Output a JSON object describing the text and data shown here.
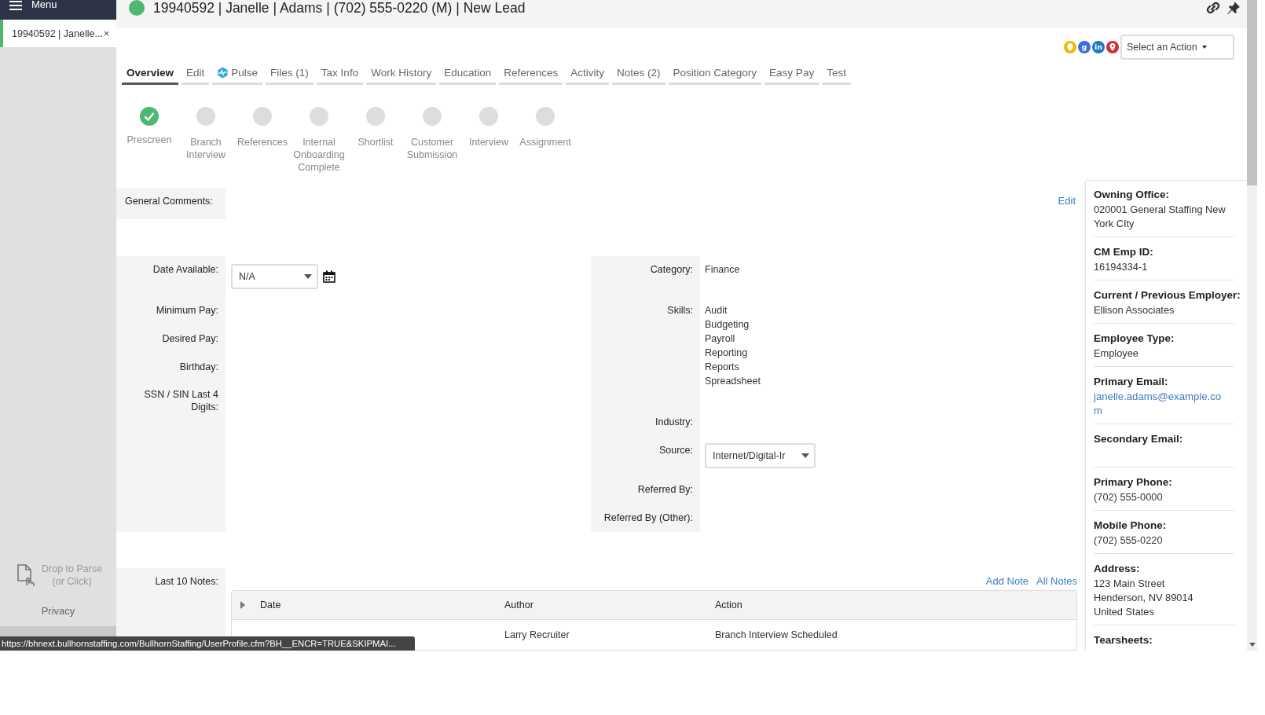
{
  "sidebar": {
    "menu_label": "Menu",
    "open_records": [
      {
        "label": "19940592 | Janelle...",
        "close": "×",
        "selected": true
      }
    ],
    "drop_zone": {
      "lines": [
        "Drop to Parse",
        "(or Click)"
      ]
    },
    "privacy_link": "Privacy"
  },
  "header": {
    "status_dot": {
      "color": "#4cb870"
    },
    "title": "19940592 | Janelle | Adams | (702) 555-0220 (M) | New Lead"
  },
  "quick_links": [
    {
      "kind": "idea"
    },
    {
      "kind": "search",
      "glyph": "g"
    },
    {
      "kind": "linkedin",
      "glyph": "in"
    },
    {
      "kind": "map"
    }
  ],
  "action_select": {
    "value": "Select an Action"
  },
  "tabs": [
    {
      "label": "Overview",
      "selected": true
    },
    {
      "label": "Edit",
      "selected": false
    },
    {
      "label": "Pulse",
      "kind": "with_icon",
      "selected": false
    },
    {
      "label": "Files (1)",
      "selected": false
    },
    {
      "label": "Tax Info",
      "selected": false
    },
    {
      "label": "Work History",
      "selected": false
    },
    {
      "label": "Education",
      "selected": false
    },
    {
      "label": "References",
      "selected": false
    },
    {
      "label": "Activity",
      "selected": false
    },
    {
      "label": "Notes (2)",
      "selected": false
    },
    {
      "label": "Position Category",
      "selected": false
    },
    {
      "label": "Easy Pay",
      "selected": false
    },
    {
      "label": "Test",
      "selected": false
    }
  ],
  "steps": [
    {
      "label": "Prescreen",
      "done": true
    },
    {
      "label": "Branch Interview",
      "done": false
    },
    {
      "label": "References",
      "done": false
    },
    {
      "label": "Internal Onboarding Complete",
      "done": false
    },
    {
      "label": "Shortlist",
      "done": false
    },
    {
      "label": "Customer Submission",
      "done": false
    },
    {
      "label": "Interview",
      "done": false
    },
    {
      "label": "Assignment",
      "done": false
    }
  ],
  "general_comments": {
    "label": "General Comments:",
    "edit_link": "Edit"
  },
  "left_fields": [
    {
      "label": "Date Available:",
      "kind": "date",
      "value": "N/A"
    },
    {
      "label": "Minimum Pay:",
      "kind": "text"
    },
    {
      "label": "Desired Pay:",
      "kind": "text"
    },
    {
      "label": "Birthday:",
      "kind": "text"
    },
    {
      "label": "SSN / SIN Last 4 Digits:",
      "kind": "text"
    }
  ],
  "right_fields": [
    {
      "label": "Category:",
      "kind": "text",
      "value": "Finance"
    },
    {
      "label": "Skills:",
      "kind": "list",
      "values": [
        "Audit",
        "Budgeting",
        "Payroll",
        "Reporting",
        "Reports",
        "Spreadsheet"
      ]
    },
    {
      "label": "Industry:",
      "kind": "text"
    },
    {
      "label": "Source:",
      "kind": "select",
      "value": "Internet/Digital-Ir"
    },
    {
      "label": "Referred By:",
      "kind": "text"
    },
    {
      "label": "Referred By (Other):",
      "kind": "text"
    }
  ],
  "details": [
    {
      "label": "Owning Office:",
      "kind": "text",
      "lines": [
        "020001 General Staffing New York CIty"
      ]
    },
    {
      "label": "CM Emp ID:",
      "kind": "text",
      "lines": [
        "16194334-1"
      ]
    },
    {
      "label": "Current / Previous Employer:",
      "kind": "text",
      "lines": [
        "Ellison Associates"
      ]
    },
    {
      "label": "Employee Type:",
      "kind": "text",
      "lines": [
        "Employee"
      ]
    },
    {
      "label": "Primary Email:",
      "kind": "link",
      "lines": [
        "janelle.adams@example.com"
      ]
    },
    {
      "label": "Secondary Email:",
      "kind": "text"
    },
    {
      "label": "Primary Phone:",
      "kind": "text",
      "lines": [
        "(702) 555-0000"
      ]
    },
    {
      "label": "Mobile Phone:",
      "kind": "text",
      "lines": [
        "(702) 555-0220"
      ]
    },
    {
      "label": "Address:",
      "kind": "text",
      "lines": [
        "123 Main Street",
        "Henderson, NV 89014",
        "United States"
      ]
    },
    {
      "label": "Tearsheets:",
      "kind": "text"
    }
  ],
  "notes": {
    "label": "Last 10 Notes:",
    "links": [
      "Add Note",
      "All Notes"
    ],
    "table": {
      "columns": [
        "Date",
        "Author",
        "Action"
      ],
      "rows": [
        {
          "author": "Larry Recruiter",
          "action": "Branch Interview Scheduled"
        }
      ]
    }
  },
  "status_tooltip": "https://bhnext.bullhornstaffing.com/BullhornStaffing/UserProfile.cfm?BH__ENCR=TRUE&SKIPMAI..."
}
